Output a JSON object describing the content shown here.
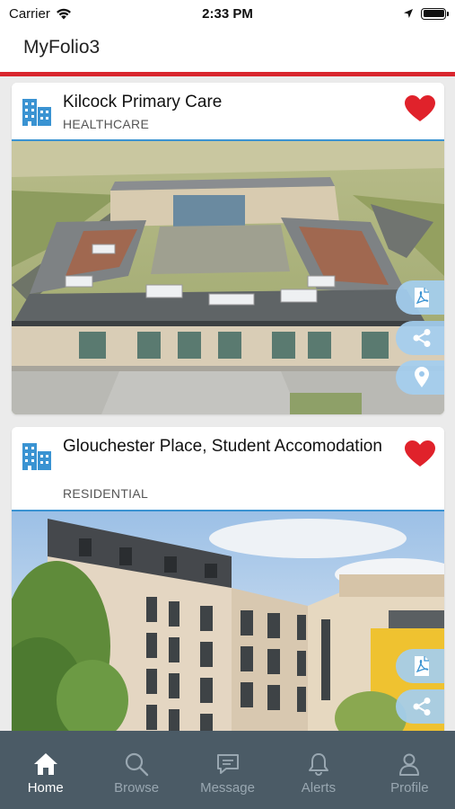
{
  "status_bar": {
    "carrier": "Carrier",
    "time": "2:33 PM"
  },
  "header": {
    "title": "MyFolio3"
  },
  "accent_colors": {
    "brand_red": "#d9262e",
    "icon_blue": "#3a93d2",
    "tabbar": "#4b5b66"
  },
  "projects": [
    {
      "name": "Kilcock Primary Care",
      "category": "HEALTHCARE",
      "favorited": true,
      "actions": [
        "pdf-icon",
        "share-icon",
        "location-icon"
      ]
    },
    {
      "name": "Glouchester Place, Student Accomodation",
      "category": "RESIDENTIAL",
      "favorited": true,
      "actions": [
        "pdf-icon",
        "share-icon"
      ]
    }
  ],
  "tabs": [
    {
      "label": "Home",
      "icon": "home-icon",
      "active": true
    },
    {
      "label": "Browse",
      "icon": "search-icon",
      "active": false
    },
    {
      "label": "Message",
      "icon": "message-icon",
      "active": false
    },
    {
      "label": "Alerts",
      "icon": "bell-icon",
      "active": false
    },
    {
      "label": "Profile",
      "icon": "person-icon",
      "active": false
    }
  ]
}
